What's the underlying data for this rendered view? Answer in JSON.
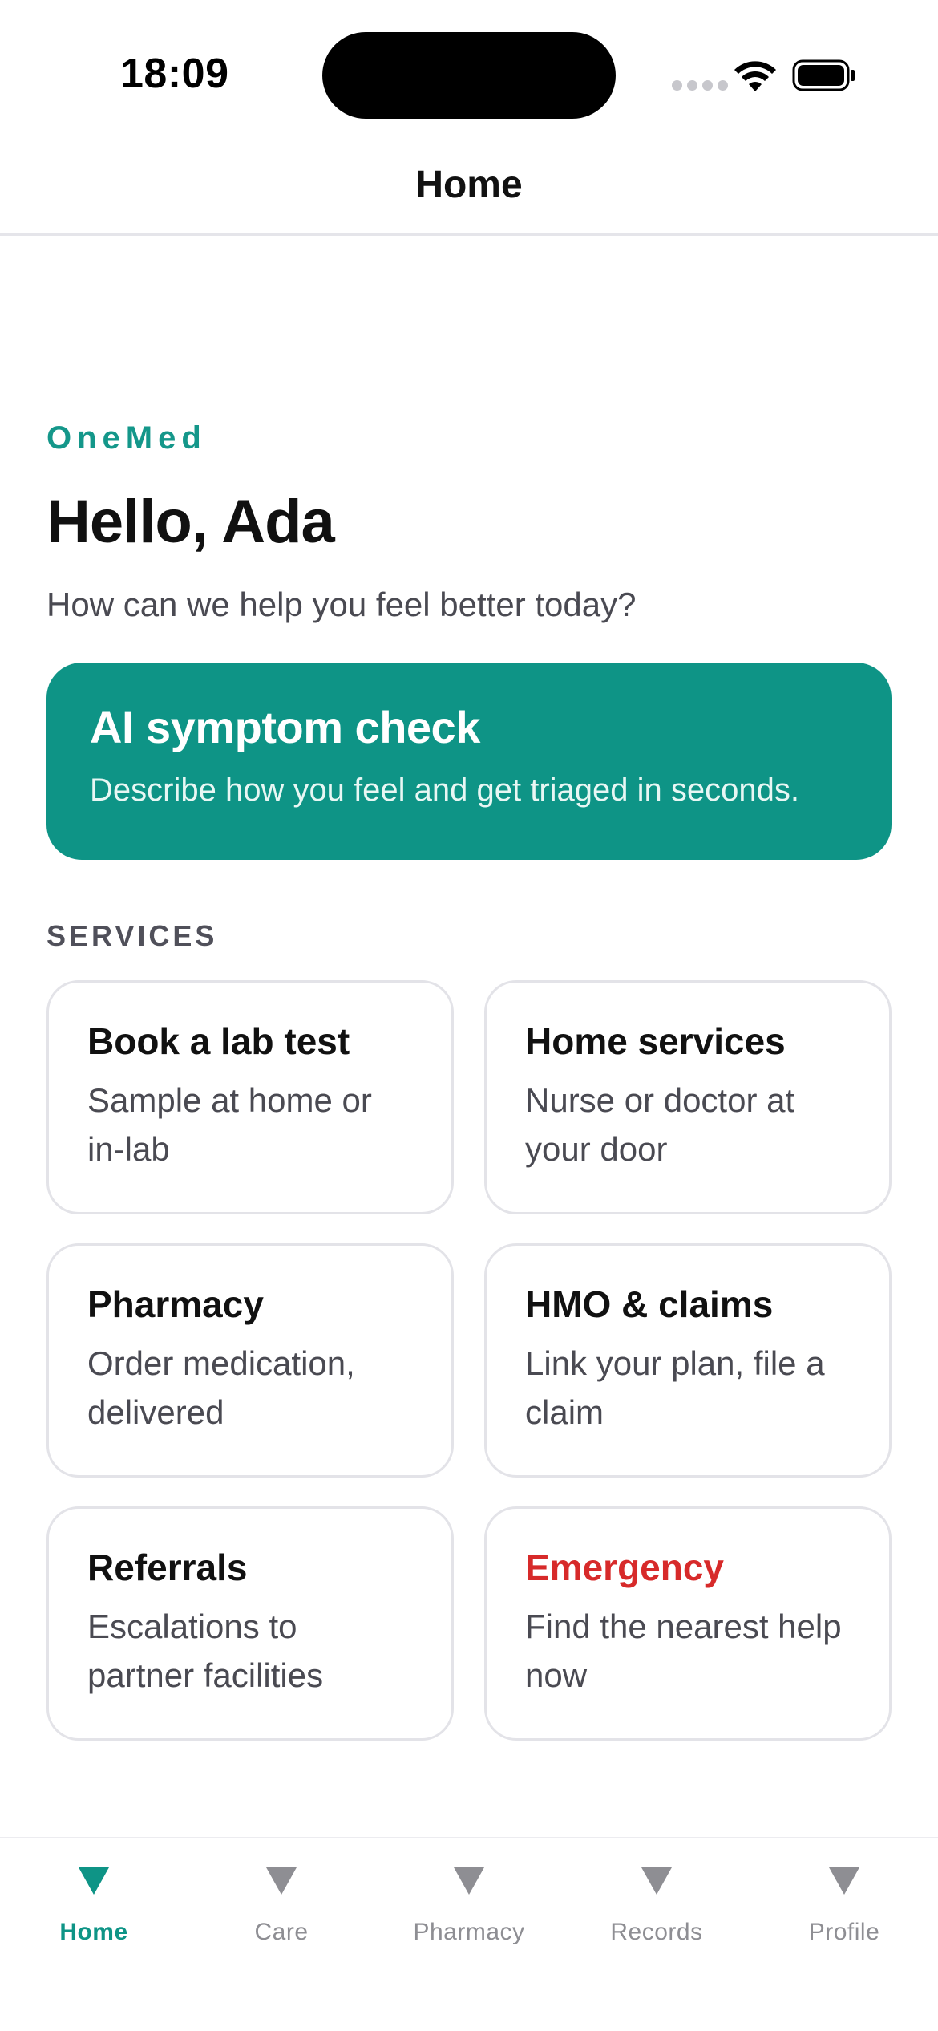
{
  "status_bar": {
    "time": "18:09"
  },
  "header": {
    "title": "Home"
  },
  "hero": {
    "brand": "OneMed",
    "greeting": "Hello, Ada",
    "subtitle": "How can we help you feel better today?"
  },
  "ai_card": {
    "title": "AI symptom check",
    "description": "Describe how you feel and get triaged in seconds."
  },
  "services": {
    "label": "SERVICES",
    "items": [
      {
        "title": "Book a lab test",
        "description": "Sample at home or in-lab"
      },
      {
        "title": "Home services",
        "description": "Nurse or doctor at your door"
      },
      {
        "title": "Pharmacy",
        "description": "Order medication, delivered"
      },
      {
        "title": "HMO & claims",
        "description": "Link your plan, file a claim"
      },
      {
        "title": "Referrals",
        "description": "Escalations to partner facilities"
      },
      {
        "title": "Emergency",
        "description": "Find the nearest help now"
      }
    ]
  },
  "tab_bar": {
    "tabs": [
      {
        "label": "Home",
        "icon": "triangle-down-icon",
        "active": true
      },
      {
        "label": "Care",
        "icon": "triangle-down-icon",
        "active": false
      },
      {
        "label": "Pharmacy",
        "icon": "triangle-down-icon",
        "active": false
      },
      {
        "label": "Records",
        "icon": "triangle-down-icon",
        "active": false
      },
      {
        "label": "Profile",
        "icon": "triangle-down-icon",
        "active": false
      }
    ]
  },
  "colors": {
    "accent": "#0e9486",
    "emergency": "#d72a2a",
    "inactive_tab": "#8e8e93"
  }
}
